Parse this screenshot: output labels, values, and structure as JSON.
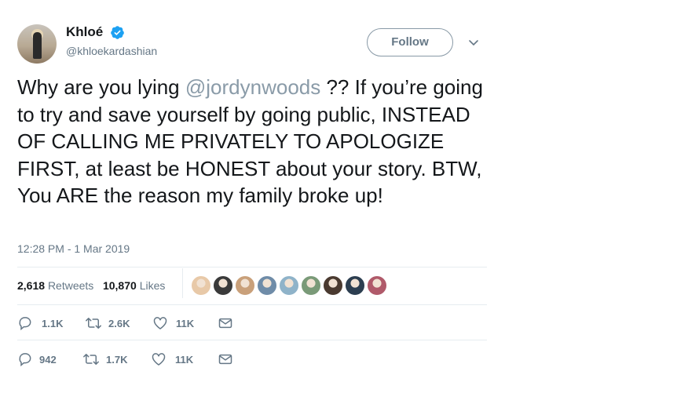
{
  "user": {
    "name": "Khloé",
    "handle": "@khloekardashian",
    "verified": true
  },
  "follow_label": "Follow",
  "tweet": {
    "text_before": "Why are you lying ",
    "mention": "@jordynwoods",
    "text_after": " ?? If you’re going to try and save yourself by going public, INSTEAD OF CALLING ME PRIVATELY TO APOLOGIZE FIRST, at least be HONEST about your story. BTW, You ARE the reason my family broke up!"
  },
  "timestamp": "12:28 PM - 1 Mar 2019",
  "stats": {
    "retweets_count": "2,618",
    "retweets_label": "Retweets",
    "likes_count": "10,870",
    "likes_label": "Likes"
  },
  "liker_avatar_colors": [
    "#e8c9a8",
    "#3a3a3a",
    "#c9a07a",
    "#6f8ca8",
    "#8fb3c9",
    "#7a9a78",
    "#4a3a30",
    "#2c3e50",
    "#b05a6a"
  ],
  "action_rows": [
    {
      "reply": "1.1K",
      "retweet": "2.6K",
      "like": "11K"
    },
    {
      "reply": "942",
      "retweet": "1.7K",
      "like": "11K"
    }
  ],
  "colors": {
    "verified": "#1da1f2",
    "mention": "#8a9ba8",
    "muted": "#657786"
  },
  "icons": [
    "verified-badge-icon",
    "chevron-down-icon",
    "reply-icon",
    "retweet-icon",
    "like-icon",
    "message-icon"
  ]
}
